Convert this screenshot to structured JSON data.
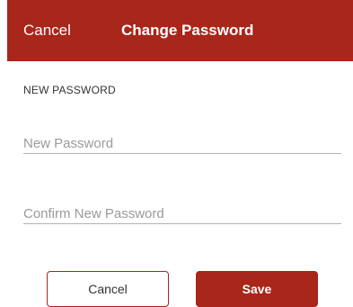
{
  "header": {
    "cancel_label": "Cancel",
    "title": "Change Password"
  },
  "form": {
    "section_label": "NEW PASSWORD",
    "new_password": {
      "value": "",
      "placeholder": "New Password"
    },
    "confirm_password": {
      "value": "",
      "placeholder": "Confirm New Password"
    }
  },
  "actions": {
    "cancel_label": "Cancel",
    "save_label": "Save"
  },
  "colors": {
    "accent": "#a8261a",
    "header_text": "#ffffff",
    "placeholder": "#9a9a9a",
    "underline": "#b3b3b3"
  }
}
